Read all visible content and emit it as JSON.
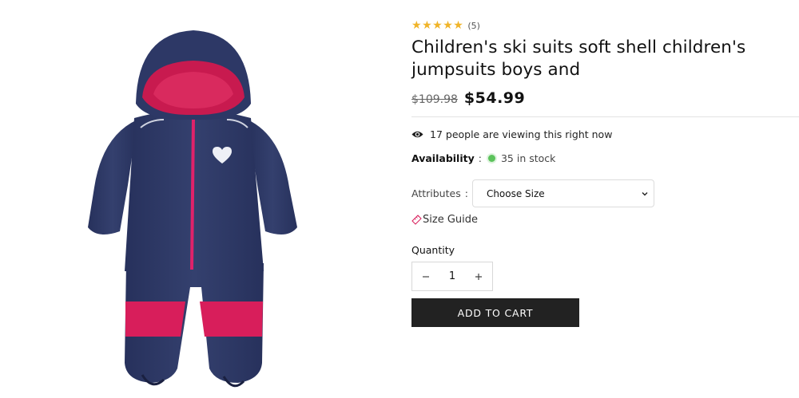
{
  "product": {
    "title": "Children's ski suits soft shell children's jumpsuits boys and",
    "rating": {
      "stars": 5,
      "count_label": "(5)"
    },
    "old_price": "$109.98",
    "new_price": "$54.99",
    "viewing_text": "17 people are viewing this right now",
    "availability_label": "Availability",
    "availability_separator": ":",
    "stock_text": "35 in stock",
    "attributes_label": "Attributes",
    "attributes_separator": ":",
    "size_select_value": "Choose Size",
    "size_guide_label": "Size Guide",
    "quantity_label": "Quantity",
    "quantity_value": "1",
    "add_to_cart_label": "ADD TO CART"
  },
  "icons": {
    "star": "star-icon",
    "eye": "eye-icon",
    "ruler": "ruler-icon",
    "chevron": "chevron-down-icon",
    "minus": "minus-icon",
    "plus": "plus-icon"
  },
  "colors": {
    "star": "#f0b429",
    "in_stock": "#5cc35c",
    "button_bg": "#222222",
    "suit_navy": "#2a3561",
    "suit_pink": "#d81e5b"
  }
}
